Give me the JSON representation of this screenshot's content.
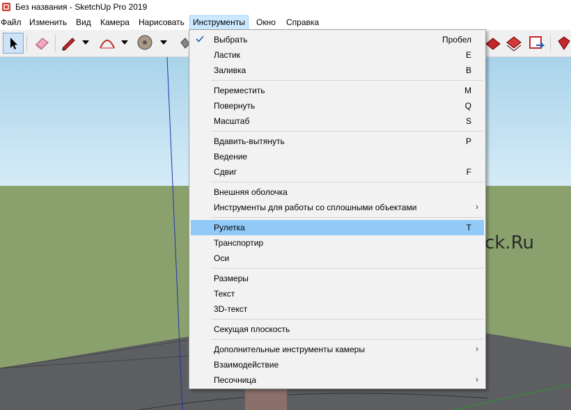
{
  "window": {
    "title": "Без названия - SketchUp Pro 2019"
  },
  "menubar": {
    "items": [
      "Файл",
      "Изменить",
      "Вид",
      "Камера",
      "Нарисовать",
      "Инструменты",
      "Окно",
      "Справка"
    ]
  },
  "dropdown": {
    "items": [
      {
        "label": "Выбрать",
        "key": "Пробел",
        "checked": true
      },
      {
        "label": "Ластик",
        "key": "E"
      },
      {
        "label": "Заливка",
        "key": "B"
      },
      {
        "label": "Переместить",
        "key": "M"
      },
      {
        "label": "Повернуть",
        "key": "Q"
      },
      {
        "label": "Масштаб",
        "key": "S"
      },
      {
        "label": "Вдавить-вытянуть",
        "key": "P"
      },
      {
        "label": "Ведение",
        "key": ""
      },
      {
        "label": "Сдвиг",
        "key": "F"
      },
      {
        "label": "Внешняя оболочка",
        "key": ""
      },
      {
        "label": "Инструменты для работы со сплошными объектами",
        "submenu": true
      },
      {
        "label": "Рулетка",
        "key": "T",
        "highlighted": true
      },
      {
        "label": "Транспортир",
        "key": ""
      },
      {
        "label": "Оси",
        "key": ""
      },
      {
        "label": "Размеры",
        "key": ""
      },
      {
        "label": "Текст",
        "key": ""
      },
      {
        "label": "3D-текст",
        "key": ""
      },
      {
        "label": "Секущая плоскость",
        "key": ""
      },
      {
        "label": "Дополнительные инструменты камеры",
        "submenu": true
      },
      {
        "label": "Взаимодействие",
        "key": ""
      },
      {
        "label": "Песочница",
        "submenu": true
      }
    ]
  },
  "viewport": {
    "watermark": "ck.Ru"
  },
  "icons": {
    "submenu_arrow": "›",
    "checkmark": "checkmark-icon"
  },
  "colors": {
    "highlight": "#91c9f7",
    "menu_active": "#cce8ff",
    "sky": "#a9d3ea",
    "ground": "#8aa16d"
  }
}
